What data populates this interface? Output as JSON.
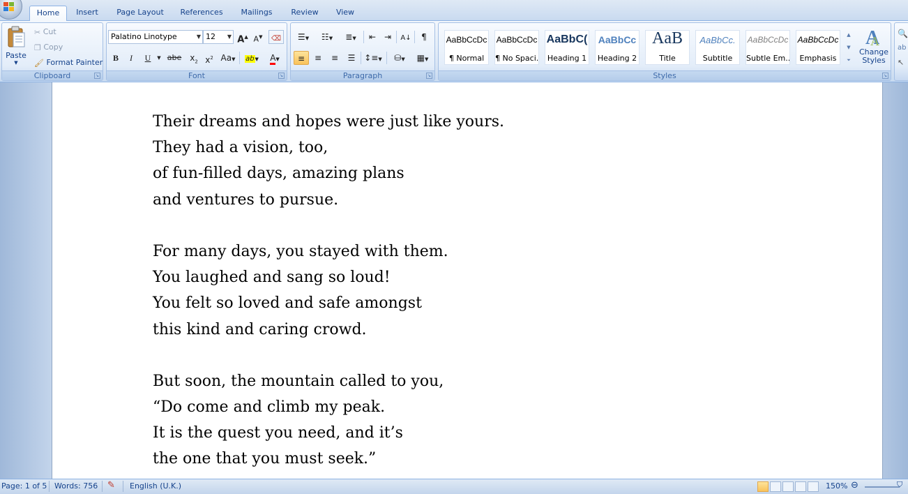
{
  "tabs": [
    "Home",
    "Insert",
    "Page Layout",
    "References",
    "Mailings",
    "Review",
    "View"
  ],
  "active_tab": "Home",
  "clipboard": {
    "label": "Clipboard",
    "paste": "Paste",
    "cut": "Cut",
    "copy": "Copy",
    "format_painter": "Format Painter"
  },
  "font": {
    "label": "Font",
    "family": "Palatino Linotype",
    "size": "12",
    "grow": "A",
    "shrink": "A",
    "bold": "B",
    "italic": "I",
    "underline": "U",
    "strike": "abe",
    "subscript": "x",
    "superscript": "x",
    "change_case": "Aa",
    "highlight": "ab",
    "font_color": "A"
  },
  "paragraph": {
    "label": "Paragraph",
    "pilcrow": "¶"
  },
  "styles": {
    "label": "Styles",
    "items": [
      {
        "sample": "AaBbCcDc",
        "name": "¶ Normal"
      },
      {
        "sample": "AaBbCcDc",
        "name": "¶ No Spaci..."
      },
      {
        "sample": "AaBbC(",
        "name": "Heading 1"
      },
      {
        "sample": "AaBbCc",
        "name": "Heading 2"
      },
      {
        "sample": "AaB",
        "name": "Title"
      },
      {
        "sample": "AaBbCc.",
        "name": "Subtitle"
      },
      {
        "sample": "AaBbCcDc",
        "name": "Subtle Em..."
      },
      {
        "sample": "AaBbCcDc",
        "name": "Emphasis"
      }
    ],
    "change_styles_1": "Change",
    "change_styles_2": "Styles"
  },
  "document": {
    "lines": [
      "Their dreams and hopes were just like yours.",
      "They had a vision, too,",
      "of fun-filled days, amazing plans",
      "and ventures to pursue.",
      "",
      "For many days, you stayed with them.",
      "You laughed and sang so loud!",
      "You felt so loved and safe amongst",
      "this kind and caring crowd.",
      "",
      "But soon, the mountain called to you,",
      "“Do come and climb my peak.",
      "It is the quest you need, and it’s",
      "the one that you must seek.”"
    ]
  },
  "status": {
    "page": "Page: 1 of 5",
    "words": "Words: 756",
    "language": "English (U.K.)",
    "zoom": "150%"
  },
  "colors": {
    "ribbon_text": "#15428b",
    "highlight_yellow": "#ffff00",
    "font_red": "#ff0000"
  }
}
